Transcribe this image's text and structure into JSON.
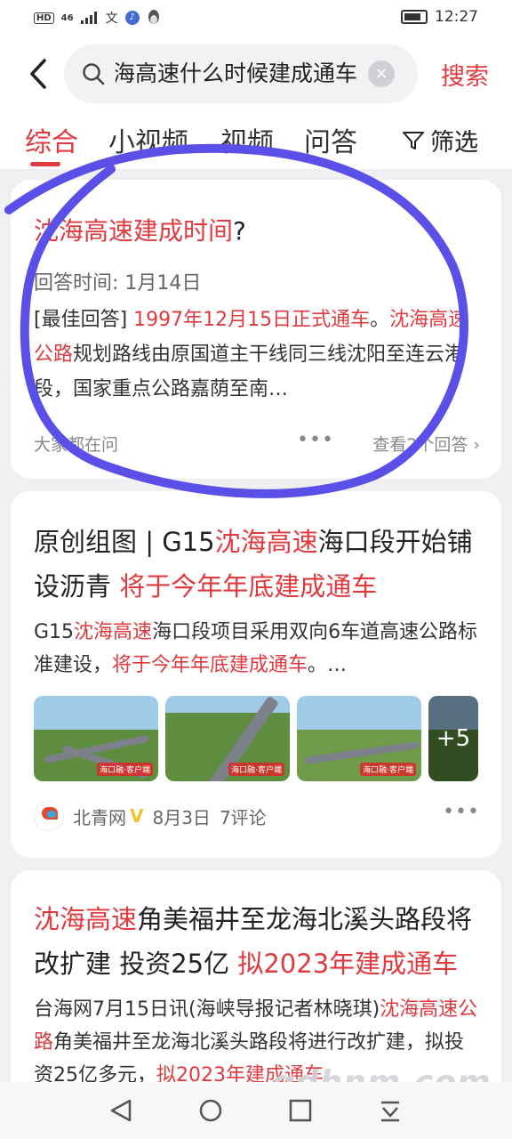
{
  "status": {
    "network": "HD",
    "signal": "46",
    "time": "12:27"
  },
  "search": {
    "query": "沈海高速什么时候建成通车",
    "button": "搜索"
  },
  "tabs": [
    "综合",
    "小视频",
    "视频",
    "问答"
  ],
  "filter_label": "筛选",
  "cards": [
    {
      "title_red": "沈海高速建成时间",
      "title_rest": "?",
      "answer_time": "回答时间: 1月14日",
      "answer_prefix": "[最佳回答] ",
      "answer_red1": "1997年12月15日正式通车",
      "answer_mid": "。",
      "answer_red2": "沈海高速公路",
      "answer_rest": "规划路线由原国道主干线同三线沈阳至连云港段，国家重点公路嘉荫至南…",
      "source": "大家都在问",
      "more": "查看2个回答"
    },
    {
      "title_a": "原创组图 | G15",
      "title_red": "沈海高速",
      "title_b": "海口段开始铺设沥青 ",
      "title_red2": "将于今年年底建成通车",
      "body_a": "G15",
      "body_red": "沈海高速",
      "body_b": "海口段项目采用双向6车道高速公路标准建设，",
      "body_red2": "将于今年年底建成通车",
      "body_c": "。…",
      "image_tag": "海口融·客户端",
      "image_more": "+5",
      "source": "北青网",
      "badge": "V",
      "date": "8月3日",
      "comments": "7评论"
    },
    {
      "title_red": "沈海高速",
      "title_a": "角美福井至龙海北溪头路段将改扩建 投资25亿 ",
      "title_red2": "拟2023年建成通车",
      "body_a": "台海网7月15日讯(海峡导报记者林晓琪)",
      "body_red": "沈海高速公路",
      "body_b": "角美福井至龙海北溪头路段将进行改扩建，拟投资25亿多元，",
      "body_red2": "拟2023年建成通车"
    }
  ],
  "watermark": "gdhnm.com",
  "colors": {
    "accent": "#e0393e",
    "annotation_circle": "#5a4fe6"
  }
}
